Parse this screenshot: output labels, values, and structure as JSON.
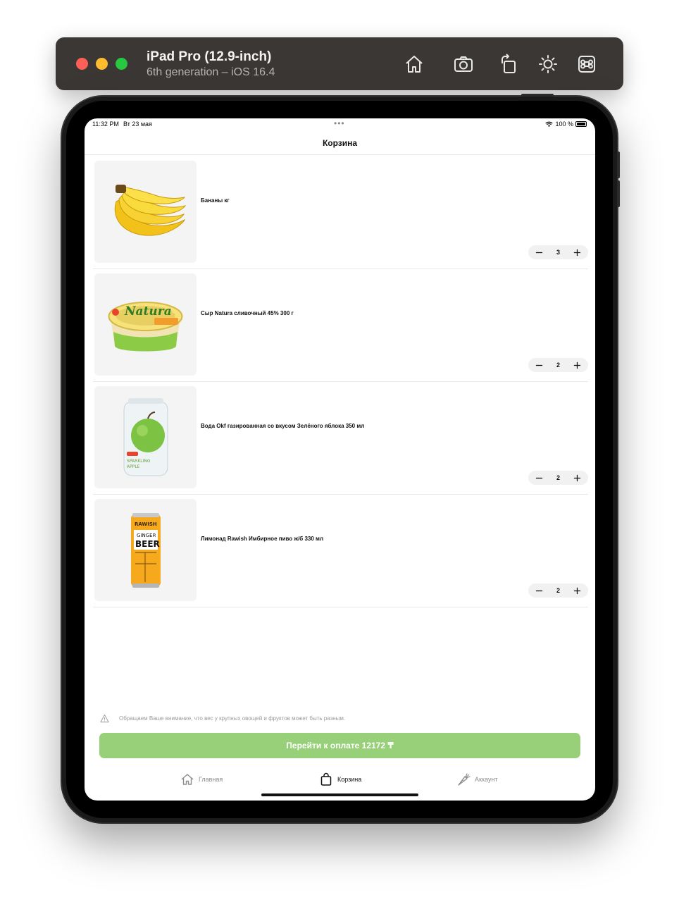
{
  "simulator": {
    "device_name": "iPad Pro (12.9-inch)",
    "device_detail": "6th generation – iOS 16.4",
    "toolbar_icons": [
      "home-icon",
      "screenshot-icon",
      "rotate-icon",
      "appearance-icon",
      "command-icon"
    ]
  },
  "status_bar": {
    "time": "11:32 PM",
    "date": "Вт 23 мая",
    "multitask_dots": "•••",
    "battery_percent": "100 %"
  },
  "header": {
    "title": "Корзина"
  },
  "cart": {
    "items": [
      {
        "name": "Бананы кг",
        "quantity": "3",
        "image_icon": "banana-icon"
      },
      {
        "name": "Сыр Natura сливочный 45% 300 г",
        "quantity": "2",
        "image_icon": "cheese-tub-icon"
      },
      {
        "name": "Вода Okf газированная со вкусом Зелёного яблока 350 мл",
        "quantity": "2",
        "image_icon": "apple-drink-bottle-icon"
      },
      {
        "name": "Лимонад Rawish Имбирное пиво ж/б 330 мл",
        "quantity": "2",
        "image_icon": "ginger-beer-can-icon"
      }
    ]
  },
  "notice": {
    "text": "Обращаем Ваше внимание, что вес у крупных овощей и фруктов может быть разным."
  },
  "checkout": {
    "label": "Перейти к оплате 12172 ₸",
    "color": "#97d078"
  },
  "tab_bar": {
    "tabs": [
      {
        "label": "Главная",
        "icon": "home-icon",
        "active": false
      },
      {
        "label": "Корзина",
        "icon": "bag-icon",
        "active": true
      },
      {
        "label": "Аккаунт",
        "icon": "carrot-icon",
        "active": false
      }
    ]
  }
}
